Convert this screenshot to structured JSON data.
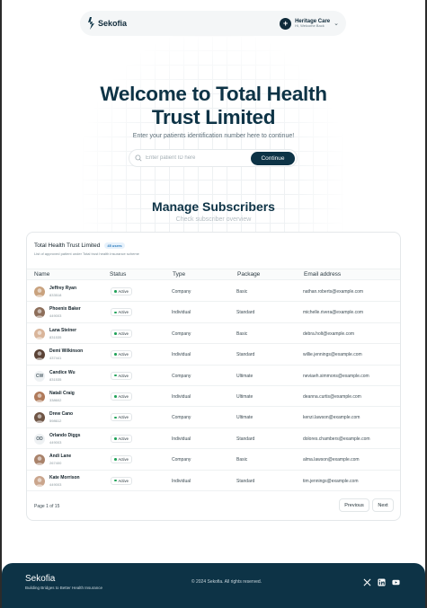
{
  "nav": {
    "brand": "Sekofia",
    "org_name": "Heritage Care",
    "org_sub": "Hi, Welcome Back"
  },
  "hero": {
    "title_line1": "Welcome to Total Health",
    "title_line2": "Trust Limited",
    "subtitle": "Enter your patients identification number here to continue!",
    "search_placeholder": "Enter patient ID here",
    "continue_label": "Continue"
  },
  "manage": {
    "title": "Manage Subscribers",
    "subtitle": "Check subscriber overview"
  },
  "table": {
    "title": "Total Health Trust Limited",
    "count_badge": "45 users",
    "description": "List of approved patient under Total trust health insurance scheme",
    "columns": [
      "Name",
      "Status",
      "Type",
      "Package",
      "Email address"
    ],
    "rows": [
      {
        "name": "Jeffrey Ryan",
        "id": "833518",
        "status": "Active",
        "type": "Company",
        "package": "Basic",
        "email": "nathan.roberts@example.com",
        "avatar": "photo"
      },
      {
        "name": "Phoenix Baker",
        "id": "449003",
        "status": "Active",
        "type": "Individual",
        "package": "Standard",
        "email": "michelle.rivera@example.com",
        "avatar": "photo"
      },
      {
        "name": "Lana Steiner",
        "id": "831535",
        "status": "Active",
        "type": "Company",
        "package": "Basic",
        "email": "debra.holt@example.com",
        "avatar": "photo"
      },
      {
        "name": "Demi Wilkinson",
        "id": "437441",
        "status": "Active",
        "type": "Individual",
        "package": "Standard",
        "email": "willie.jennings@example.com",
        "avatar": "photo"
      },
      {
        "name": "Candice Wu",
        "id": "831535",
        "status": "Active",
        "type": "Company",
        "package": "Ultimate",
        "email": "neviaeh.simmons@example.com",
        "avatar": "CW"
      },
      {
        "name": "Natali Craig",
        "id": "338602",
        "status": "Active",
        "type": "Individual",
        "package": "Ultimate",
        "email": "deanna.curtis@example.com",
        "avatar": "photo"
      },
      {
        "name": "Drew Cano",
        "id": "598612",
        "status": "Active",
        "type": "Company",
        "package": "Ultimate",
        "email": "kenzi.lawson@example.com",
        "avatar": "photo"
      },
      {
        "name": "Orlando Diggs",
        "id": "449003",
        "status": "Active",
        "type": "Individual",
        "package": "Standard",
        "email": "dolores.chambers@example.com",
        "avatar": "OD"
      },
      {
        "name": "Andi Lane",
        "id": "267400",
        "status": "Active",
        "type": "Company",
        "package": "Basic",
        "email": "alma.lawson@example.com",
        "avatar": "photo"
      },
      {
        "name": "Kate Morrison",
        "id": "449003",
        "status": "Active",
        "type": "Individual",
        "package": "Standard",
        "email": "tim.jennings@example.com",
        "avatar": "photo"
      }
    ],
    "page_info": "Page 1 of 15",
    "prev_label": "Previous",
    "next_label": "Next"
  },
  "footer": {
    "brand": "Sekofia",
    "tagline": "Building Bridges to Better Health Insurance",
    "copyright": "© 2024 Sekofia. All rights reserved.",
    "social_icons": [
      "x-icon",
      "linkedin-icon",
      "youtube-icon"
    ]
  },
  "colors": {
    "primary": "#0d3346",
    "active_dot": "#22a35a",
    "badge_blue": "#2a7bbd"
  }
}
